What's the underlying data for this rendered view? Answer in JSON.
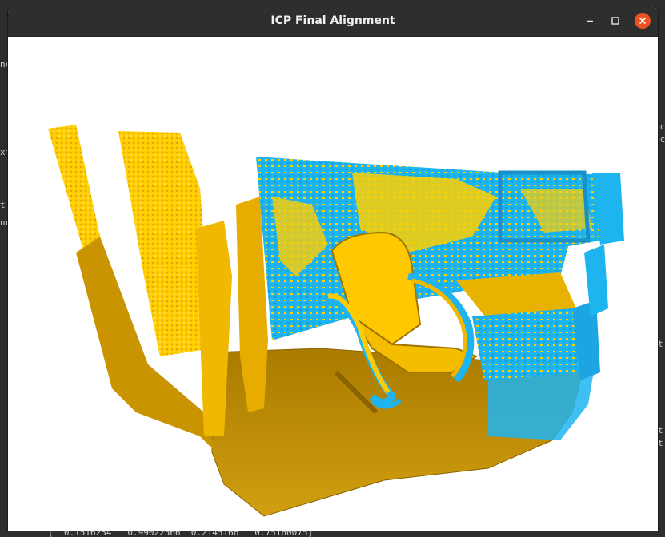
{
  "window": {
    "title": "ICP Final Alignment",
    "controls": [
      "minimize-icon",
      "maximize-icon",
      "close-icon"
    ]
  },
  "viewport": {
    "content": "point-cloud-render",
    "colors": {
      "source": "#ffd400",
      "source_shade": "#b88a00",
      "target": "#1eb4f0",
      "background": "#ffffff"
    }
  },
  "terminal_fragments": [
    "nc",
    "xt",
    "t",
    "nc",
    "nc",
    "ec",
    "t",
    "t",
    "t",
    "[  0.1516234   0.99022566  0.2145166   0.75160075]"
  ],
  "colors": {
    "titlebar": "#2e2e2e",
    "close_button": "#e95420"
  }
}
